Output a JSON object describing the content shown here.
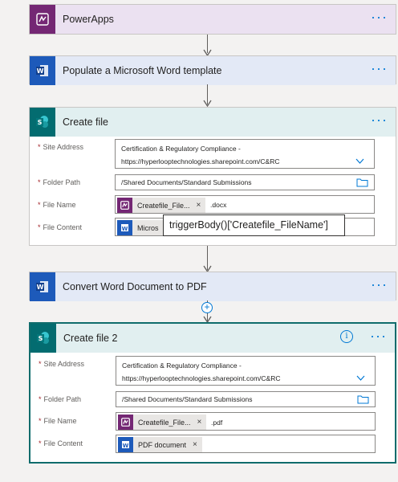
{
  "steps": {
    "powerapps": {
      "title": "PowerApps",
      "more": "···"
    },
    "word_template": {
      "title": "Populate a Microsoft Word template",
      "more": "···"
    },
    "create_file": {
      "title": "Create file",
      "more": "···",
      "site_address_label": "Site Address",
      "site_address_line1": "Certification & Regulatory Compliance -",
      "site_address_line2": "https://hyperlooptechnologies.sharepoint.com/C&RC",
      "folder_path_label": "Folder Path",
      "folder_path_value": "/Shared Documents/Standard Submissions",
      "file_name_label": "File Name",
      "file_name_chip": "Createfile_File...",
      "file_name_suffix": ".docx",
      "file_content_label": "File Content",
      "file_content_chip": "Micros"
    },
    "convert": {
      "title": "Convert Word Document to PDF",
      "more": "···"
    },
    "create_file_2": {
      "title": "Create file 2",
      "info": "i",
      "more": "···",
      "site_address_label": "Site Address",
      "site_address_line1": "Certification & Regulatory Compliance -",
      "site_address_line2": "https://hyperlooptechnologies.sharepoint.com/C&RC",
      "folder_path_label": "Folder Path",
      "folder_path_value": "/Shared Documents/Standard Submissions",
      "file_name_label": "File Name",
      "file_name_chip": "Createfile_File...",
      "file_name_suffix": ".pdf",
      "file_content_label": "File Content",
      "file_content_chip": "PDF document"
    }
  },
  "tooltip": "triggerBody()['Createfile_FileName']",
  "required_marker": "*",
  "chip_remove": "×",
  "add_step": "+",
  "icons": {
    "powerapps": "powerapps-icon",
    "word": "word-icon",
    "sharepoint": "sharepoint-icon",
    "folder": "folder-icon",
    "chevron": "chevron-down-icon",
    "arrow": "arrow-down-icon"
  },
  "colors": {
    "powerapps": "#742774",
    "word": "#1d5aba",
    "sharepoint": "#036c70",
    "accent": "#0078d4",
    "selected_border": "#0f6c6c"
  }
}
